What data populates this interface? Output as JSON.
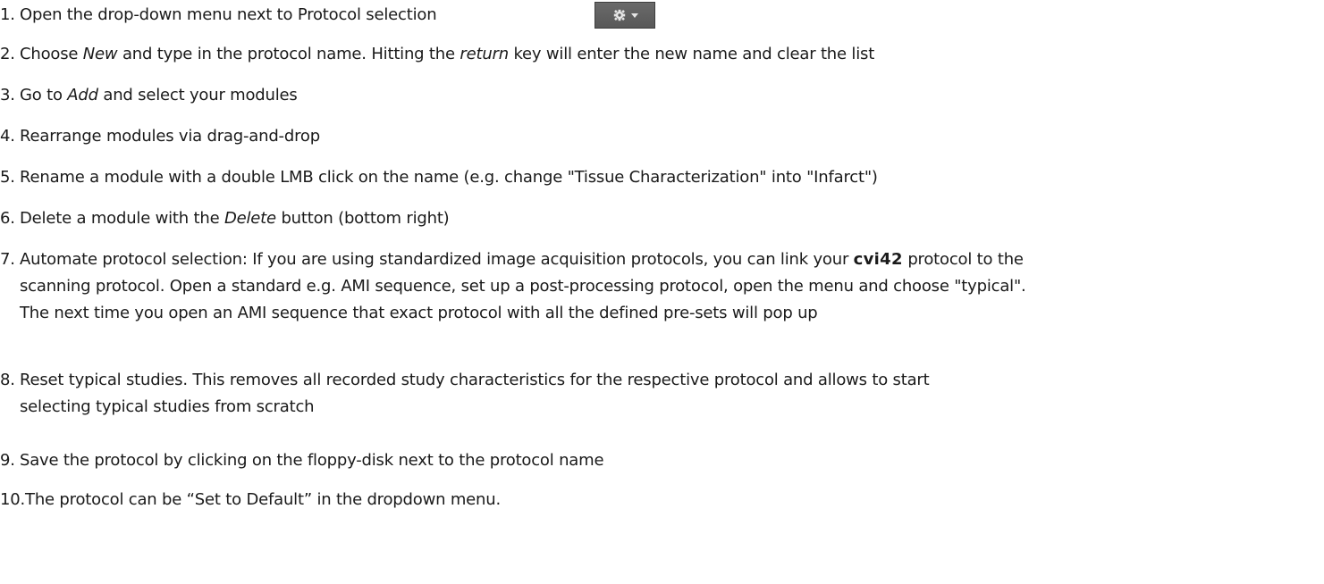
{
  "steps": [
    {
      "num": "1.",
      "parts": [
        "Open the drop-down menu next to Protocol selection"
      ]
    },
    {
      "num": "2.",
      "parts": [
        "Choose ",
        "New",
        " and type in the protocol name. Hitting the ",
        "return",
        " key will enter the new name and clear the list"
      ]
    },
    {
      "num": "3.",
      "parts": [
        "Go to ",
        "Add",
        " and select your modules"
      ]
    },
    {
      "num": "4.",
      "parts": [
        "Rearrange modules via drag-and-drop"
      ]
    },
    {
      "num": "5.",
      "parts": [
        "Rename a module with a double LMB click on the name (e.g. change \"Tissue Characterization\" into \"Infarct\")"
      ]
    },
    {
      "num": "6.",
      "parts": [
        "Delete a module with the ",
        "Delete",
        " button (bottom right)"
      ]
    },
    {
      "num": "7.",
      "parts": [
        "Automate protocol selection: If you are using standardized image acquisition protocols, you can link your ",
        "cvi42",
        " protocol to the",
        "scanning protocol. Open a standard e.g. AMI sequence, set up a post-processing protocol, open the menu and choose \"typical\".",
        "The next time you open an AMI sequence that exact protocol with all the defined pre-sets will pop up"
      ]
    },
    {
      "num": "8.",
      "parts": [
        "Reset typical studies. This removes all recorded study characteristics for the respective protocol and allows to start",
        "selecting typical studies from scratch"
      ]
    },
    {
      "num": "9.",
      "parts": [
        "Save the protocol by clicking on the floppy-disk next to the protocol name"
      ]
    },
    {
      "num": "10.",
      "parts": [
        "The protocol can be “Set to Default” in the dropdown menu."
      ]
    }
  ],
  "menu_button": {
    "icon": "gear-icon",
    "caret": "chevron-down-icon",
    "background": "#5f5f5f"
  }
}
